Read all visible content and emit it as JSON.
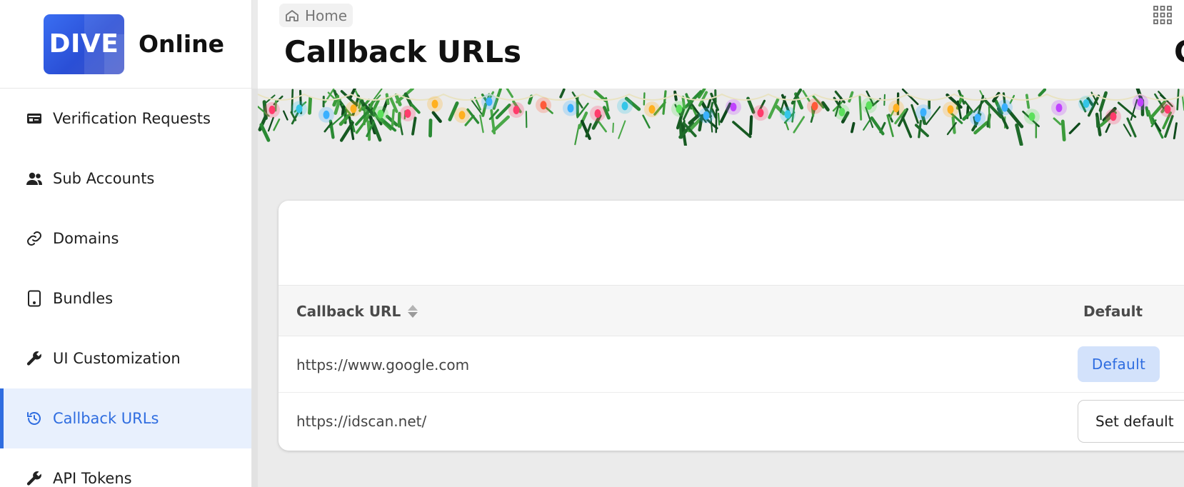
{
  "brand": {
    "logo_text": "DIVE",
    "name": "Online"
  },
  "sidebar": {
    "items": [
      {
        "label": "Verification Requests",
        "icon": "id-card-icon",
        "active": false
      },
      {
        "label": "Sub Accounts",
        "icon": "users-icon",
        "active": false
      },
      {
        "label": "Domains",
        "icon": "link-icon",
        "active": false
      },
      {
        "label": "Bundles",
        "icon": "tablet-icon",
        "active": false
      },
      {
        "label": "UI Customization",
        "icon": "wrench-icon",
        "active": false
      },
      {
        "label": "Callback URLs",
        "icon": "history-icon",
        "active": true
      },
      {
        "label": "API Tokens",
        "icon": "key-icon",
        "active": false
      }
    ]
  },
  "header": {
    "breadcrumb": "Home",
    "title": "Callback URLs",
    "title_right_partial": "C"
  },
  "table": {
    "columns": {
      "url": "Callback URL",
      "default": "Default"
    },
    "rows": [
      {
        "url": "https://www.google.com",
        "action": "Default",
        "is_default": true
      },
      {
        "url": "https://idscan.net/",
        "action": "Set default",
        "is_default": false
      }
    ]
  },
  "colors": {
    "accent": "#2f6de0",
    "active_bg": "#e8f0fd",
    "default_btn_bg": "#d3e2fb"
  }
}
